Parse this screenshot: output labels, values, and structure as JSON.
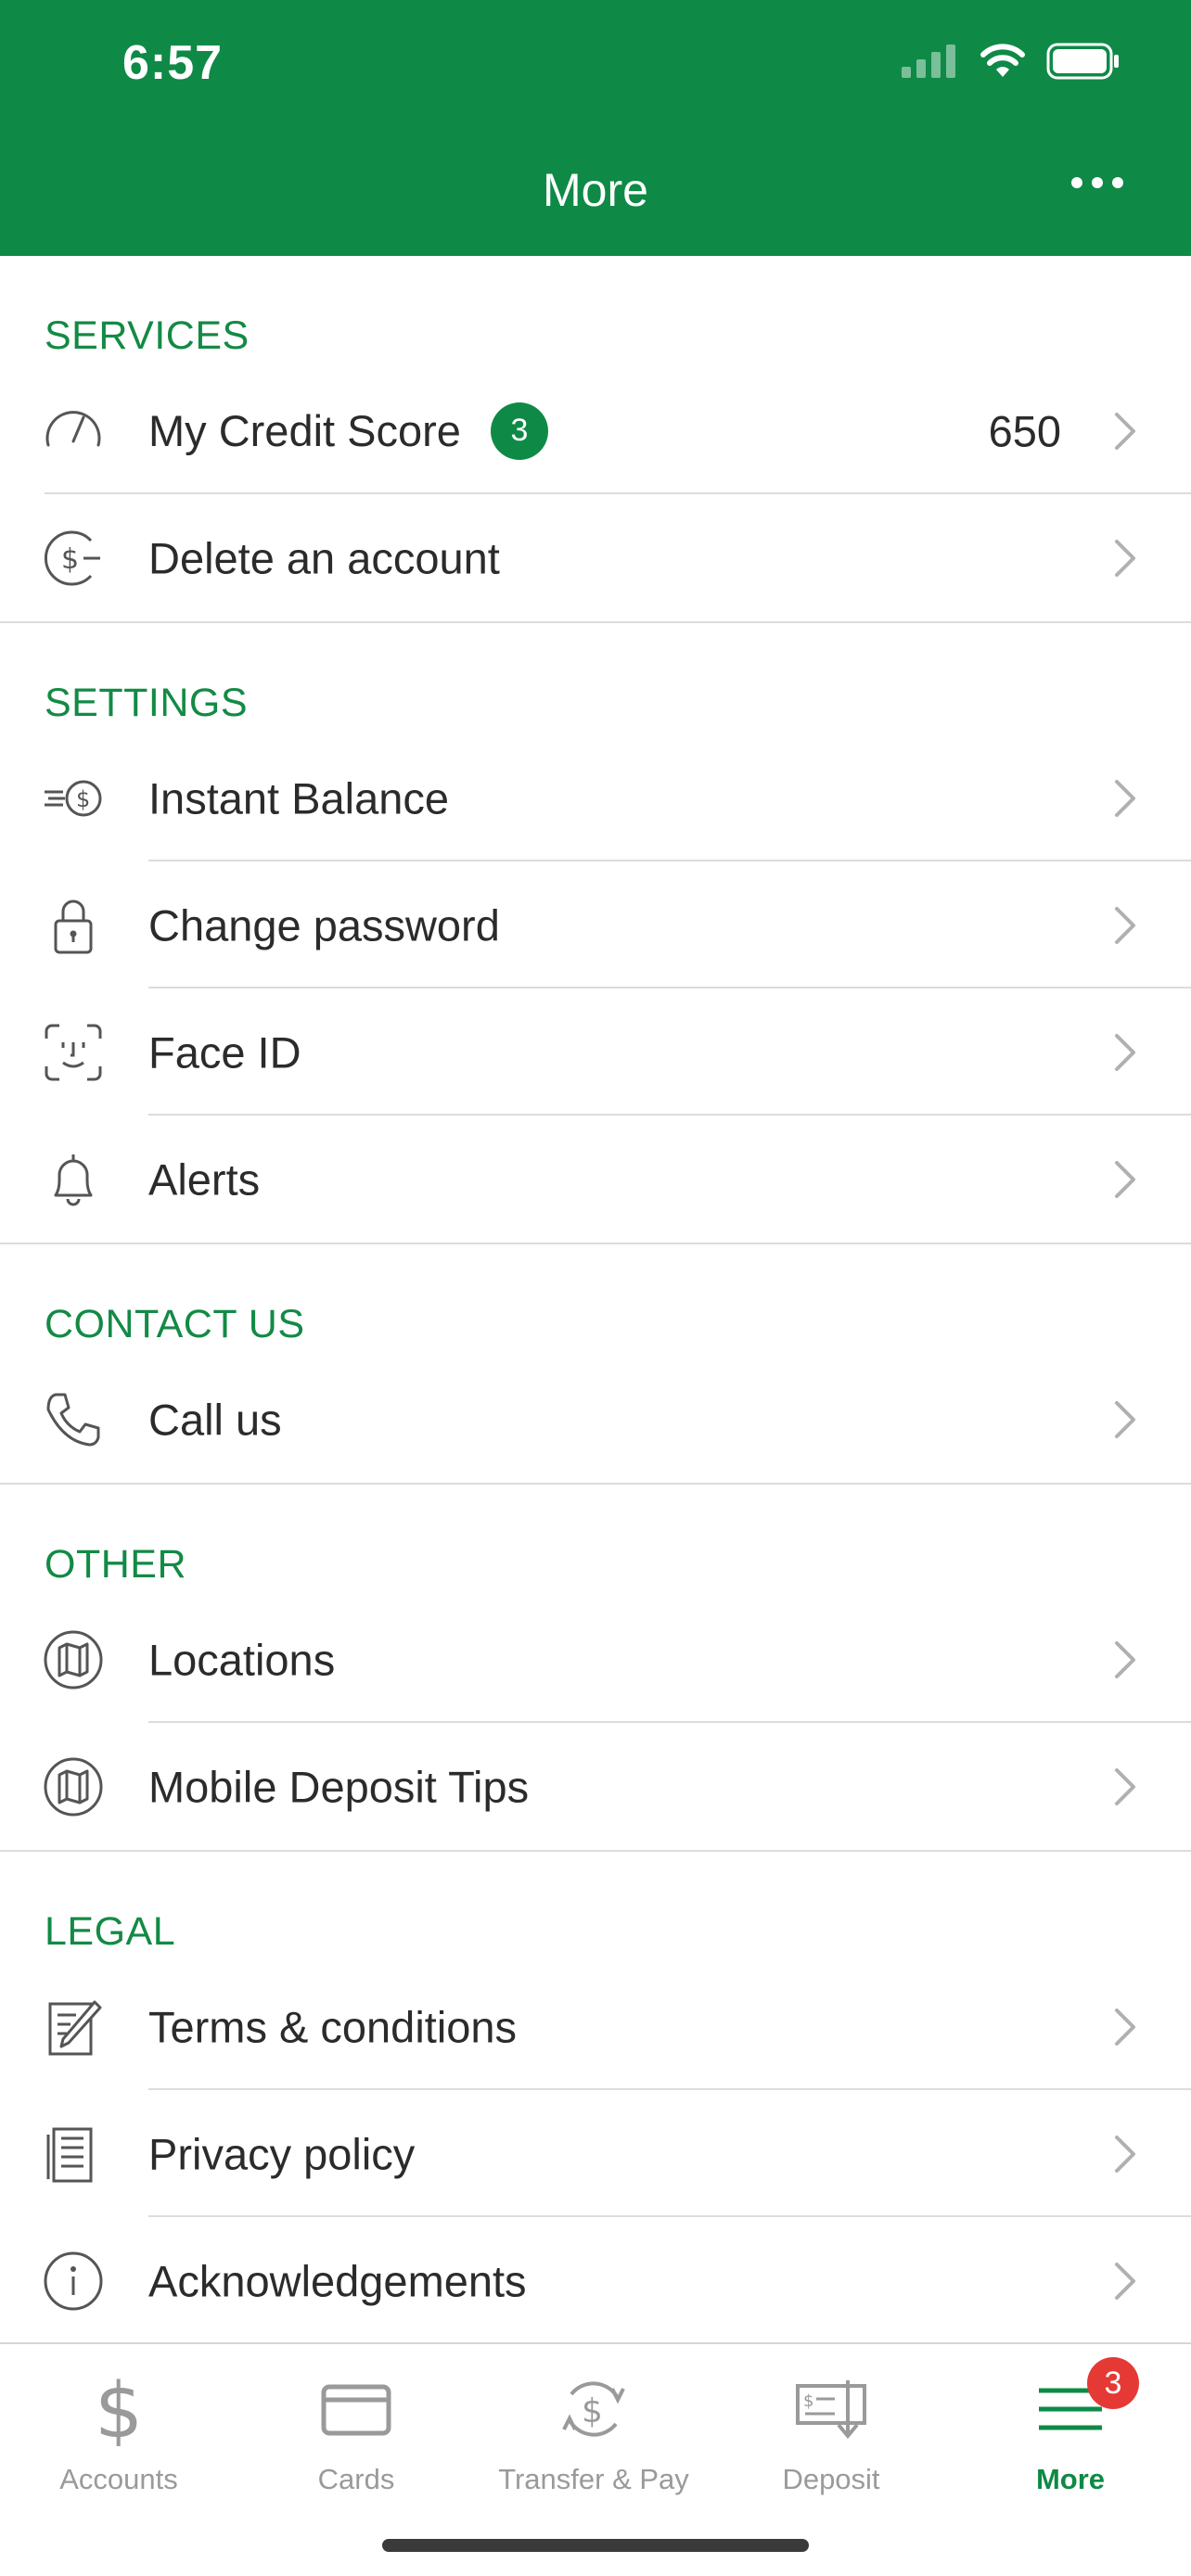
{
  "status_bar": {
    "time": "6:57"
  },
  "header": {
    "title": "More"
  },
  "sections": [
    {
      "title": "SERVICES",
      "items": [
        {
          "label": "My Credit Score",
          "badge": "3",
          "value": "650",
          "icon": "gauge-icon"
        },
        {
          "label": "Delete an account",
          "icon": "dollar-minus-icon"
        }
      ]
    },
    {
      "title": "SETTINGS",
      "items": [
        {
          "label": "Instant Balance",
          "icon": "fast-dollar-icon"
        },
        {
          "label": "Change password",
          "icon": "lock-icon"
        },
        {
          "label": "Face ID",
          "icon": "face-id-icon"
        },
        {
          "label": "Alerts",
          "icon": "bell-icon"
        }
      ]
    },
    {
      "title": "CONTACT US",
      "items": [
        {
          "label": "Call us",
          "icon": "phone-icon"
        }
      ]
    },
    {
      "title": "OTHER",
      "items": [
        {
          "label": "Locations",
          "icon": "map-icon"
        },
        {
          "label": "Mobile Deposit Tips",
          "icon": "map-icon"
        }
      ]
    },
    {
      "title": "LEGAL",
      "items": [
        {
          "label": "Terms & conditions",
          "icon": "document-pen-icon"
        },
        {
          "label": "Privacy policy",
          "icon": "document-lines-icon"
        },
        {
          "label": "Acknowledgements",
          "icon": "info-icon"
        }
      ]
    }
  ],
  "tabbar": {
    "tabs": [
      {
        "label": "Accounts",
        "icon": "dollar-icon"
      },
      {
        "label": "Cards",
        "icon": "card-icon"
      },
      {
        "label": "Transfer & Pay",
        "icon": "transfer-dollar-icon"
      },
      {
        "label": "Deposit",
        "icon": "check-deposit-icon"
      },
      {
        "label": "More",
        "icon": "menu-icon",
        "badge": "3",
        "active": true
      }
    ]
  },
  "colors": {
    "brand_green": "#0e8a46",
    "section_title": "#138a45",
    "badge_red": "#e53935",
    "inactive_tab": "#9a9a9a"
  }
}
